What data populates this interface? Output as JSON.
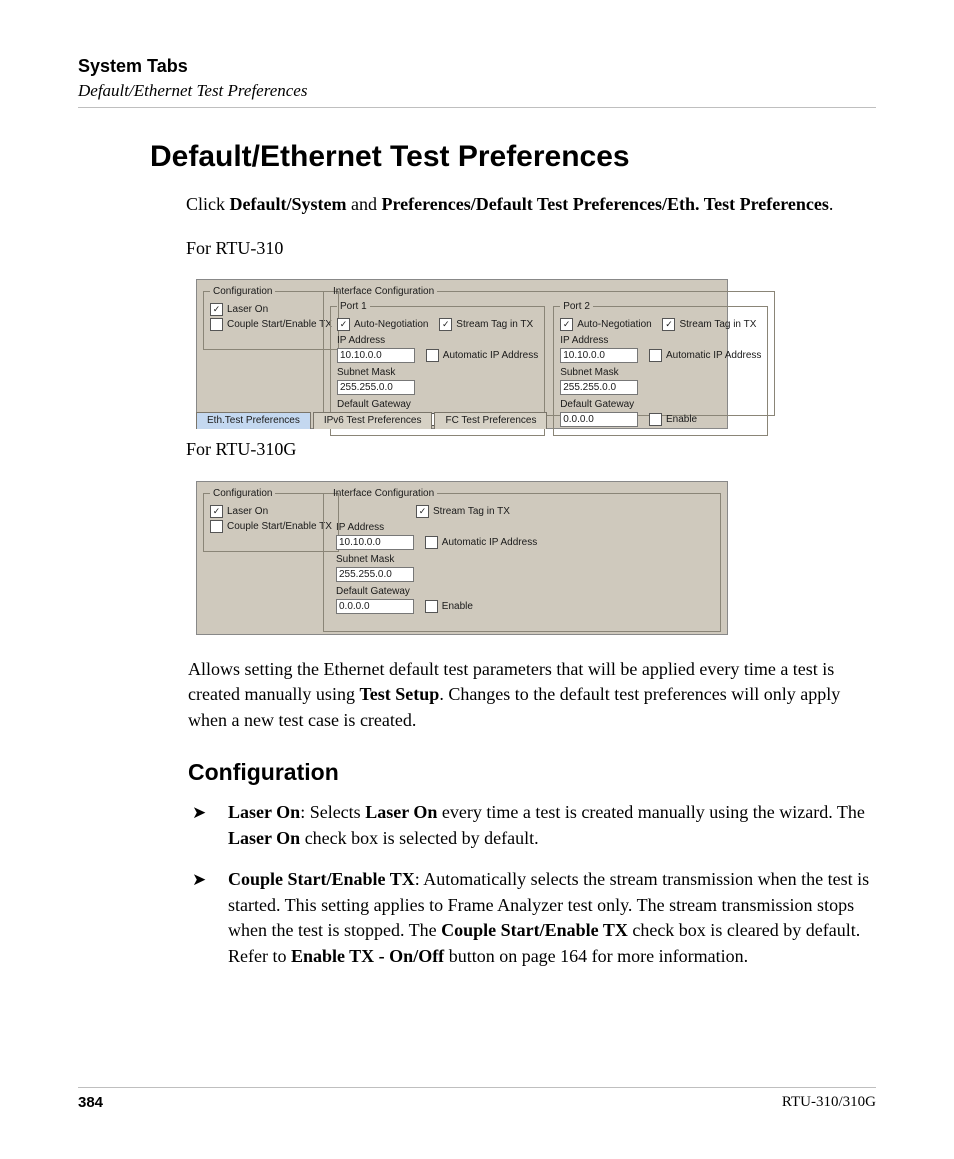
{
  "header": {
    "chapter": "System Tabs",
    "section": "Default/Ethernet Test Preferences"
  },
  "title": "Default/Ethernet Test Preferences",
  "intro": {
    "pre": "Click ",
    "b1": "Default/System",
    "mid": " and ",
    "b2": "Preferences/Default Test Preferences/Eth. Test Preferences",
    "post": "."
  },
  "for310": "For RTU-310",
  "for310g": "For RTU-310G",
  "shot1": {
    "cfg_title": "Configuration",
    "laser": "Laser On",
    "couple": "Couple Start/Enable TX",
    "ifc_title": "Interface Configuration",
    "p1": "Port 1",
    "p2": "Port 2",
    "auto": "Auto-Negotiation",
    "stream": "Stream Tag in TX",
    "ip_lbl": "IP Address",
    "ip_val": "10.10.0.0",
    "ip_auto": "Automatic IP Address",
    "sm_lbl": "Subnet Mask",
    "sm_val": "255.255.0.0",
    "gw_lbl": "Default Gateway",
    "gw_val": "0.0.0.0",
    "gw_en": "Enable",
    "tab1": "Eth.Test Preferences",
    "tab2": "IPv6 Test Preferences",
    "tab3": "FC Test Preferences"
  },
  "shot2": {
    "cfg_title": "Configuration",
    "laser": "Laser On",
    "couple": "Couple Start/Enable TX",
    "ifc_title": "Interface Configuration",
    "stream": "Stream Tag in TX",
    "ip_lbl": "IP Address",
    "ip_val": "10.10.0.0",
    "ip_auto": "Automatic IP Address",
    "sm_lbl": "Subnet Mask",
    "sm_val": "255.255.0.0",
    "gw_lbl": "Default Gateway",
    "gw_val": "0.0.0.0",
    "gw_en": "Enable"
  },
  "desc": {
    "t1": "Allows setting the Ethernet default test parameters that will be applied every time a test is created manually using ",
    "b1": "Test Setup",
    "t2": ". Changes to the default test preferences will only apply when a new test case is created."
  },
  "cfg_heading": "Configuration",
  "b_laser": {
    "lead": "Laser On",
    "t1": ": Selects ",
    "b1": "Laser On",
    "t2": " every time a test is created manually using the wizard. The ",
    "b2": "Laser On",
    "t3": " check box is selected by default."
  },
  "b_couple": {
    "lead": "Couple Start/Enable TX",
    "t1": ": Automatically selects the stream transmission when the test is started. This setting applies to Frame Analyzer test only. The stream transmission stops when the test is stopped. The ",
    "b1": "Couple Start/Enable TX",
    "t2": " check box is cleared by default. Refer to ",
    "b2": "Enable TX - On/Off",
    "t3": " button on page 164 for more information."
  },
  "footer": {
    "page": "384",
    "doc": "RTU-310/310G"
  }
}
